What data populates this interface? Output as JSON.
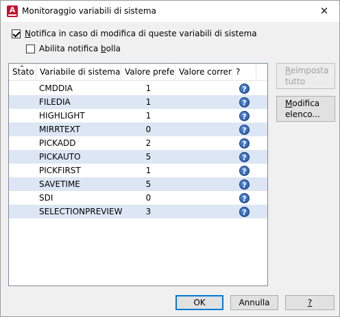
{
  "window": {
    "title": "Monitoraggio variabili di sistema",
    "close_glyph": "✕"
  },
  "options": {
    "notify": {
      "label_u": "N",
      "label_rest": "otifica in caso di modifica di queste variabili di sistema",
      "checked": true
    },
    "balloon": {
      "label_pre": "Abilita notifica ",
      "label_u": "b",
      "label_rest": "olla",
      "checked": false
    }
  },
  "table": {
    "headers": {
      "stato": "Stato",
      "variabile": "Variabile di sistema",
      "preferito": "Valore preferi",
      "corrente": "Valore corrent",
      "help": "?"
    },
    "rows": [
      {
        "name": "CMDDIA",
        "preferred": "1",
        "current": ""
      },
      {
        "name": "FILEDIA",
        "preferred": "1",
        "current": ""
      },
      {
        "name": "HIGHLIGHT",
        "preferred": "1",
        "current": ""
      },
      {
        "name": "MIRRTEXT",
        "preferred": "0",
        "current": ""
      },
      {
        "name": "PICKADD",
        "preferred": "2",
        "current": ""
      },
      {
        "name": "PICKAUTO",
        "preferred": "5",
        "current": ""
      },
      {
        "name": "PICKFIRST",
        "preferred": "1",
        "current": ""
      },
      {
        "name": "SAVETIME",
        "preferred": "5",
        "current": ""
      },
      {
        "name": "SDI",
        "preferred": "0",
        "current": ""
      },
      {
        "name": "SELECTIONPREVIEW",
        "preferred": "3",
        "current": ""
      }
    ],
    "help_glyph": "?"
  },
  "buttons": {
    "reset": {
      "line1_u": "R",
      "line1_rest": "eimposta",
      "line2": "tutto",
      "enabled": false
    },
    "edit": {
      "line1_u": "M",
      "line1_rest": "odifica",
      "line2": "elenco..."
    },
    "ok": "OK",
    "cancel": "Annulla",
    "help": "?"
  },
  "colors": {
    "accent": "#0078d7",
    "row_alt": "#dce6f4",
    "app_icon": "#c8102e"
  }
}
